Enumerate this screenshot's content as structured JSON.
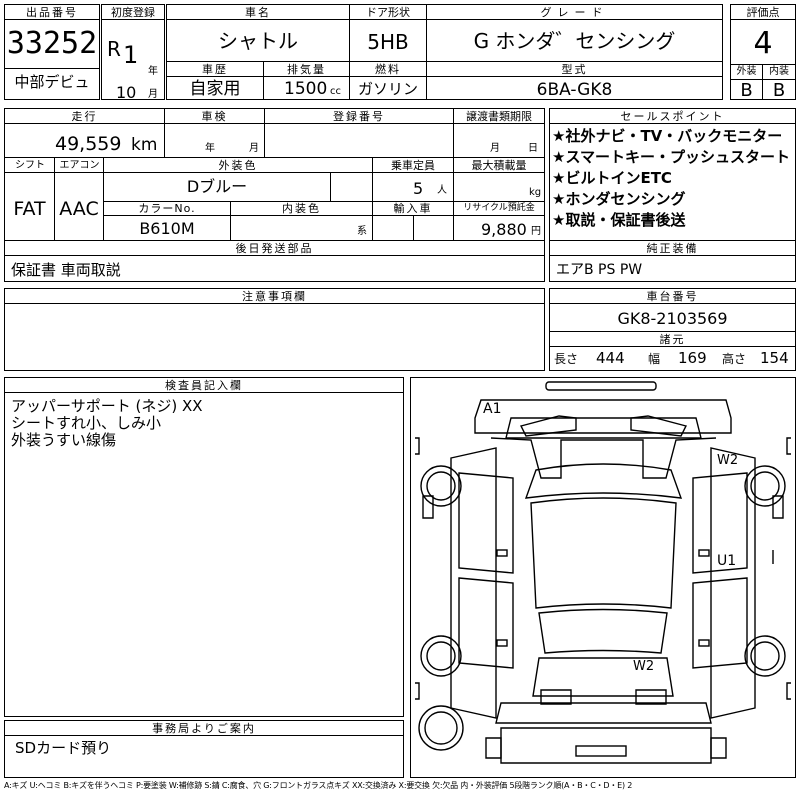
{
  "header": {
    "lot_label": "出品番号",
    "lot_number": "33252",
    "first_reg_label": "初度登録",
    "era_letter": "R",
    "year_num": "1",
    "year_unit": "年",
    "month_num": "10",
    "month_unit": "月",
    "name_label": "車名",
    "name_value": "シャトル",
    "door_label": "ドア形状",
    "door_value": "5HB",
    "grade_label": "グレード",
    "grade_value": "G ホンダ゛センシング",
    "score_label": "評価点",
    "score_value": "4",
    "ext_label": "外装",
    "int_label": "内装",
    "ext_value": "B",
    "int_value": "B",
    "debut_value": "中部デビュ",
    "history_label": "車歴",
    "history_value": "自家用",
    "displacement_label": "排気量",
    "displacement_value": "1500",
    "displacement_unit": "cc",
    "fuel_label": "燃料",
    "fuel_value": "ガソリン",
    "model_label": "型式",
    "model_value": "6BA-GK8"
  },
  "row2": {
    "mileage_label": "走行",
    "mileage_value": "49,559",
    "mileage_unit": "km",
    "inspection_label": "車検",
    "insp_year_unit": "年",
    "insp_month_unit": "月",
    "regno_label": "登録番号",
    "transfer_label": "譲渡書類期限",
    "transfer_month_unit": "月",
    "transfer_day_unit": "日",
    "sales_label": "セールスポイント",
    "sales_points": [
      "★社外ナビ・TV・バックモニター",
      "★スマートキー・プッシュスタート",
      "★ビルトインETC",
      "★ホンダセンシング",
      "★取説・保証書後送"
    ]
  },
  "row3": {
    "shift_label": "シフト",
    "shift_value": "FAT",
    "ac_label": "エアコン",
    "ac_value": "AAC",
    "exterior_color_label": "外装色",
    "exterior_color_value": "Dブルー",
    "capacity_label": "乗車定員",
    "capacity_value": "5",
    "capacity_unit": "人",
    "load_label": "最大積載量",
    "load_unit": "kg",
    "color_no_label": "カラーNo.",
    "color_no_value": "B610M",
    "interior_color_label": "内装色",
    "interior_color_unit": "系",
    "import_label": "輸入車",
    "recycle_label": "リサイクル預託金",
    "recycle_value": "9,880",
    "recycle_unit": "円"
  },
  "later_parts": {
    "label": "後日発送部品",
    "value": "保証書 車両取説"
  },
  "equipment": {
    "label": "純正装備",
    "value": "エアB PS PW"
  },
  "caution": {
    "label": "注意事項欄"
  },
  "chassis": {
    "label": "車台番号",
    "value": "GK8-2103569",
    "dims_label": "諸元",
    "length_label": "長さ",
    "length_value": "444",
    "width_label": "幅",
    "width_value": "169",
    "height_label": "高さ",
    "height_value": "154"
  },
  "inspector": {
    "label": "検査員記入欄",
    "lines": [
      "アッパーサポート (ネジ) XX",
      "シートすれ小、しみ小",
      "外装うすい線傷"
    ]
  },
  "office": {
    "label": "事務局よりご案内",
    "value": "SDカード預り"
  },
  "diagram": {
    "marks": [
      "A1",
      "W2",
      "U1",
      "W2"
    ]
  },
  "legend": "A:キズ U:ヘコミ B:キズを伴うヘコミ P:要塗装 W:補修跡 S:錆 C:腐食、穴 G:フロントガラス点キズ XX:交換済み X:要交換 欠:欠品 内・外装評価 5段階ランク順(A・B・C・D・E) 2"
}
